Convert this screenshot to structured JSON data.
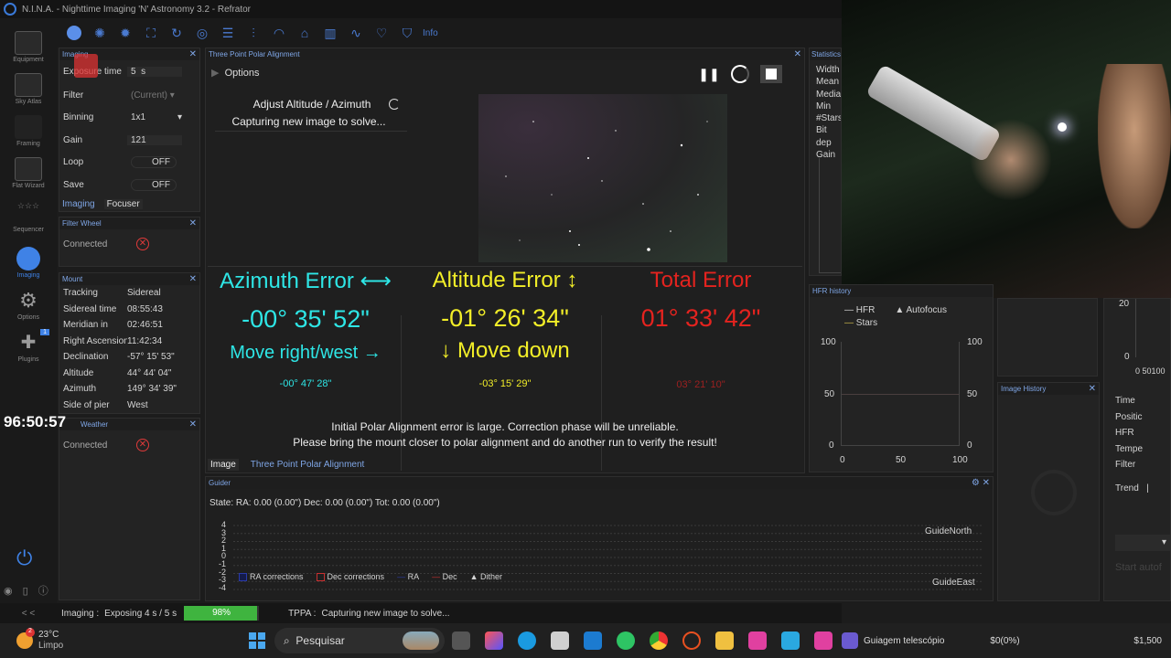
{
  "window": {
    "title": "N.I.N.A. - Nighttime Imaging 'N' Astronomy 3.2 - Refrator"
  },
  "nav": [
    {
      "label": "Equipment"
    },
    {
      "label": "Sky Atlas"
    },
    {
      "label": "Framing"
    },
    {
      "label": "Flat Wizard"
    },
    {
      "label": "Sequencer"
    },
    {
      "label": "Imaging"
    },
    {
      "label": "Options"
    },
    {
      "label": "Plugins",
      "badge": "1"
    }
  ],
  "toolbar": {
    "info_label": "Info"
  },
  "imaging": {
    "title": "Imaging",
    "exposure_label": "Exposure time",
    "exposure_value": "5",
    "exposure_unit": "s",
    "filter_label": "Filter",
    "filter_value": "(Current)",
    "binning_label": "Binning",
    "binning_value": "1x1",
    "gain_label": "Gain",
    "gain_value": "121",
    "loop_label": "Loop",
    "loop_value": "OFF",
    "save_label": "Save",
    "save_value": "OFF",
    "tab_imaging": "Imaging",
    "tab_focuser": "Focuser"
  },
  "filter_wheel": {
    "title": "Filter Wheel",
    "connected_label": "Connected"
  },
  "mount": {
    "title": "Mount",
    "rows": [
      {
        "k": "Tracking",
        "v": "Sidereal"
      },
      {
        "k": "Sidereal time",
        "v": "08:55:43"
      },
      {
        "k": "Meridian in",
        "v": "02:46:51"
      },
      {
        "k": "Right Ascension",
        "v": "11:42:34"
      },
      {
        "k": "Declination",
        "v": "-57° 15' 53\""
      },
      {
        "k": "Altitude",
        "v": "44° 44' 04\""
      },
      {
        "k": "Azimuth",
        "v": "149° 34' 39\""
      },
      {
        "k": "Side of pier",
        "v": "West"
      }
    ]
  },
  "timer": "96:50:57",
  "weather": {
    "title": "Weather",
    "connected_label": "Connected"
  },
  "tppa": {
    "title": "Three Point Polar Alignment",
    "options_label": "Options",
    "step_label": "Adjust Altitude / Azimuth",
    "step_status": "Capturing new image to solve...",
    "az_title": "Azimuth Error ⟷",
    "az_value": "-00° 35' 52\"",
    "az_move": "Move right/west →",
    "az_sub": "-00° 47' 28\"",
    "alt_title": "Altitude Error ↕",
    "alt_value": "-01° 26' 34\"",
    "alt_move": "↓ Move down",
    "alt_sub": "-03° 15' 29\"",
    "tot_title": "Total Error",
    "tot_value": "01° 33' 42\"",
    "tot_sub": "03° 21' 10\"",
    "warn1": "Initial Polar Alignment error is large. Correction phase will be unreliable.",
    "warn2": "Please bring the mount closer to polar alignment and do another run to verify the result!",
    "tab_image": "Image",
    "tab_tppa": "Three Point Polar Alignment"
  },
  "statistics": {
    "title": "Statistics",
    "labels": [
      "Width",
      "Mean",
      "Media",
      "Min",
      "#Stars",
      "Bit dep",
      "Gain"
    ]
  },
  "hfr": {
    "title": "HFR history",
    "legend_hfr": "HFR",
    "legend_autofocus": "Autofocus",
    "legend_stars": "Stars",
    "y_left": [
      "100",
      "50",
      "0"
    ],
    "y_right": [
      "100",
      "50",
      "0"
    ],
    "x": [
      "0",
      "50",
      "100"
    ]
  },
  "image_history": {
    "title": "Image History"
  },
  "right_panel": {
    "labels": [
      "Time",
      "Positic",
      "HFR",
      "Tempe",
      "Filter",
      "Trend"
    ],
    "trend_value": "|",
    "ticks": [
      "20",
      "0",
      "0 50100"
    ],
    "start_label": "Start autof"
  },
  "guider": {
    "title": "Guider",
    "state": "State:  RA: 0.00 (0.00\")  Dec: 0.00 (0.00\")  Tot: 0.00 (0.00\")",
    "y_ticks": [
      "4",
      "3",
      "2",
      "1",
      "0",
      "-1",
      "-2",
      "-3",
      "-4"
    ],
    "north": "GuideNorth",
    "east": "GuideEast",
    "legend": [
      "RA corrections",
      "Dec corrections",
      "RA",
      "Dec",
      "Dither"
    ],
    "colors": {
      "ra": "#2a3aa8",
      "dec": "#c83030"
    }
  },
  "status": {
    "collapse": "< <",
    "imaging_label": "Imaging :",
    "imaging_text": "Exposing 4 s / 5 s",
    "progress_text": "98%",
    "progress": 0.98,
    "tppa_label": "TPPA :",
    "tppa_text": "Capturing new image to solve..."
  },
  "taskbar": {
    "temp": "23°C",
    "condition": "Limpo",
    "badge": "2",
    "search": "Pesquisar",
    "app_title": "Guiagem telescópio",
    "price1": "$0(0%)",
    "price2": "$1,500"
  },
  "colors": {
    "accent": "#3f82e6",
    "cyan": "#2ee6e6",
    "yellow": "#f2ee28",
    "red": "#e4231f",
    "progress": "#3fb43f"
  }
}
